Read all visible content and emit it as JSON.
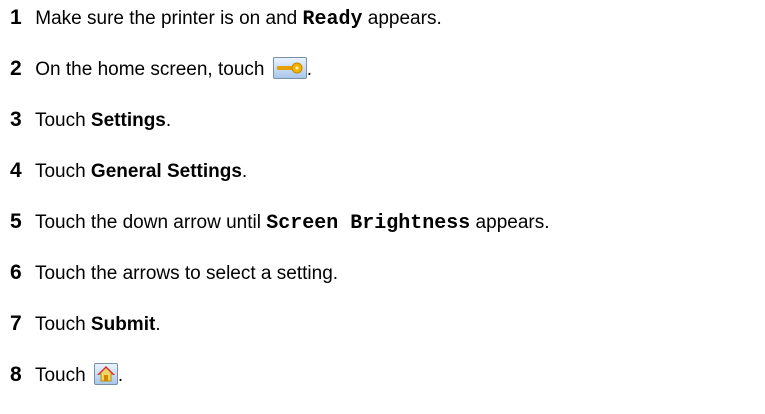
{
  "steps": [
    {
      "number": "1",
      "before": "Make sure the printer is on and ",
      "code": "Ready",
      "after": " appears."
    },
    {
      "number": "2",
      "before": "On the home screen, touch ",
      "icon": "key-icon",
      "after": "."
    },
    {
      "number": "3",
      "before": "Touch ",
      "bold": "Settings",
      "after": "."
    },
    {
      "number": "4",
      "before": "Touch ",
      "bold": "General Settings",
      "after": "."
    },
    {
      "number": "5",
      "before": "Touch the down arrow until ",
      "code": "Screen Brightness",
      "after": " appears."
    },
    {
      "number": "6",
      "before": "Touch the arrows to select a setting."
    },
    {
      "number": "7",
      "before": "Touch ",
      "bold": "Submit",
      "after": "."
    },
    {
      "number": "8",
      "before": "Touch ",
      "icon": "home-icon",
      "after": "."
    }
  ],
  "colors": {
    "text": "#000000",
    "icon_border": "#7a8fa8",
    "icon_fill": "#a9c6ea",
    "key_gold": "#e8a000"
  }
}
